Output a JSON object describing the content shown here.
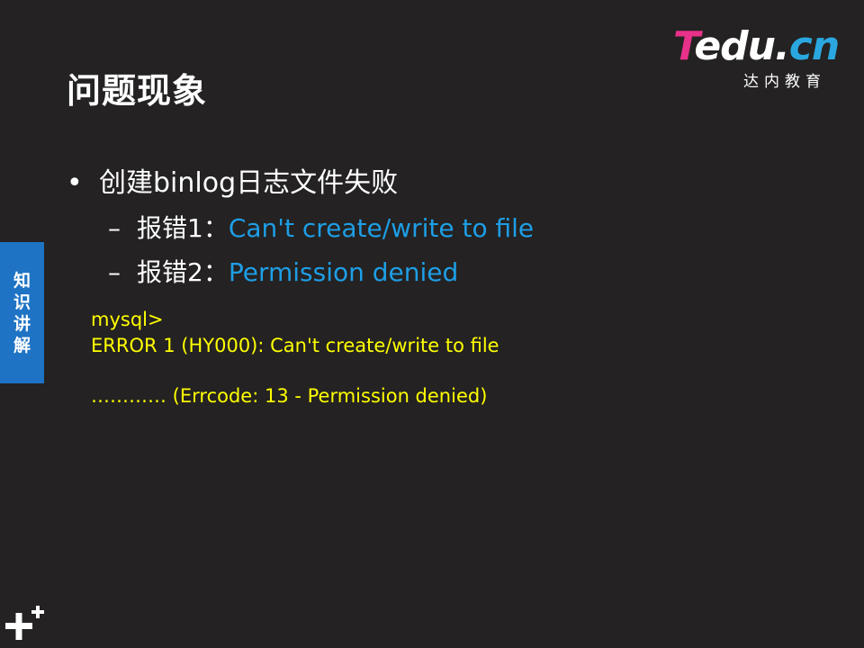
{
  "title": "问题现象",
  "logo": {
    "brand_t": "T",
    "brand_mid": "edu.",
    "brand_cn": "cn",
    "subtitle": "达内教育"
  },
  "side_tab": {
    "chars": [
      "知",
      "识",
      "讲",
      "解"
    ]
  },
  "bullets": {
    "main_marker": "•",
    "main": "创建binlog日志文件失败",
    "sub_marker": "–",
    "sub1_prefix": "报错1：",
    "sub1_highlight": "Can't create/write to file",
    "sub2_prefix": "报错2：",
    "sub2_highlight": "Permission denied"
  },
  "code_lines": [
    "mysql>",
    "ERROR 1 (HY000): Can't create/write to file",
    "………… (Errcode: 13 - Permission denied)"
  ],
  "colors": {
    "background": "#242222",
    "text": "#ffffff",
    "highlight": "#1e9ee6",
    "code": "#ffff00",
    "side_tab": "#1e73c4",
    "logo_accent": "#e8318a"
  },
  "icons": {
    "corner_mark": "plus-plus-icon"
  }
}
